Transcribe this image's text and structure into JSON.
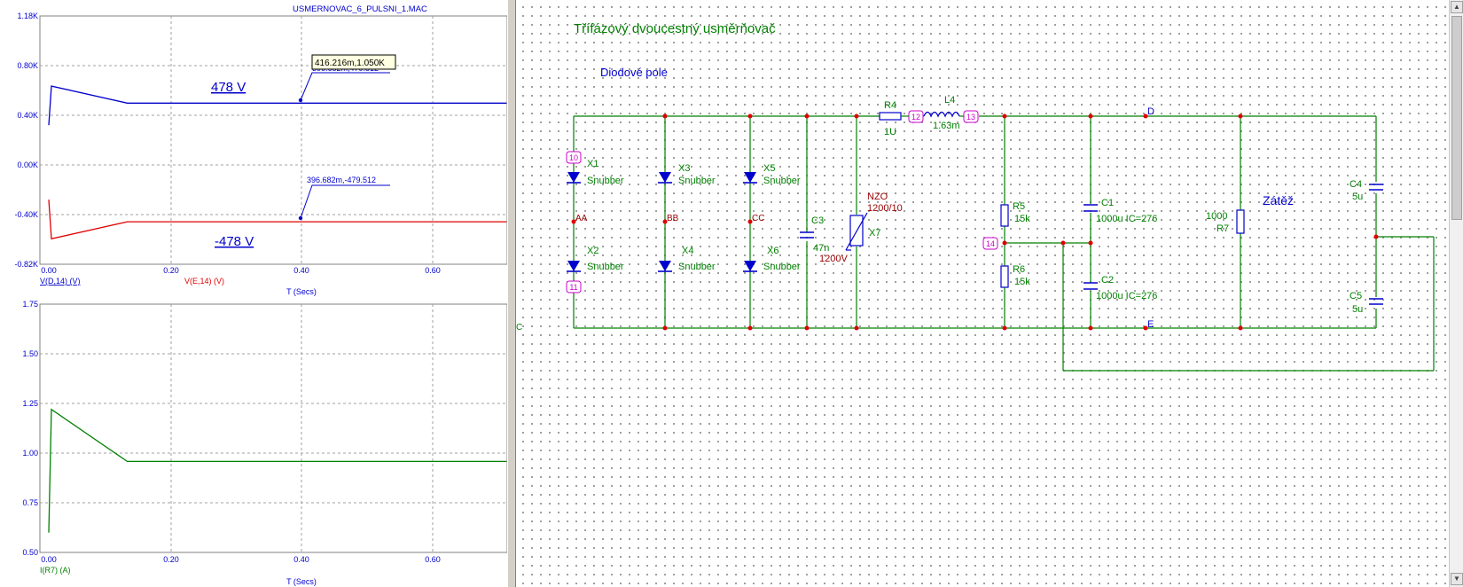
{
  "plot_window": {
    "file_title": "USMERNOVAC_6_PULSNI_1.MAC",
    "cursor_tooltip": "416.216m,1.050K",
    "top_plot": {
      "y_ticks": [
        "1.18K",
        "0.80K",
        "0.40K",
        "0.00K",
        "-0.40K",
        "-0.82K"
      ],
      "x_ticks": [
        "0.00",
        "0.20",
        "0.40",
        "0.60"
      ],
      "x_label": "T (Secs)",
      "legend": [
        "V(D,14) (V)",
        "V(E,14) (V)"
      ],
      "annotation_pos": "478 V",
      "annotation_neg": "-478 V",
      "cursor_pos_partial": "396.682m,479.512",
      "cursor_neg": "396.682m,-479.512"
    },
    "bottom_plot": {
      "y_ticks": [
        "1.75",
        "1.50",
        "1.25",
        "1.00",
        "0.75",
        "0.50"
      ],
      "x_ticks": [
        "0.00",
        "0.20",
        "0.40",
        "0.60"
      ],
      "x_label": "T (Secs)",
      "legend": [
        "I(R7) (A)"
      ]
    }
  },
  "schematic": {
    "title": "Třífázový dvoucestný usměrňovač",
    "subtitle": "Diodové pole",
    "load_label": "Zátěž",
    "nodes": {
      "n10": "10",
      "n11": "11",
      "n12": "12",
      "n13": "13",
      "n14": "14",
      "AA": "AA",
      "BB": "BB",
      "CC": "CC",
      "D": "D",
      "E": "E",
      "C": "C"
    },
    "components": {
      "X1": "X1",
      "X2": "X2",
      "X3": "X3",
      "X4": "X4",
      "X5": "X5",
      "X6": "X6",
      "X7": "X7",
      "snubber": "Snubber",
      "C3": "C3",
      "C3_val": "47n",
      "C3_volt": "1200V",
      "NZO": "NZO",
      "NZO_val": "1200/10",
      "R4": "R4",
      "R4_val": "1U",
      "L4": "L4",
      "L4_val": "1.63m",
      "R5": "R5",
      "R5_val": "15k",
      "R6": "R6",
      "R6_val": "15k",
      "C1": "C1",
      "C1_val": "1000u IC=276",
      "C2": "C2",
      "C2_val": "1000u IC=276",
      "R7": "R7",
      "R7_val": "1000",
      "C4": "C4",
      "C4_val": "5u",
      "C5": "C5",
      "C5_val": "5u"
    }
  },
  "chart_data": [
    {
      "type": "line",
      "x_label": "T (Secs)",
      "xlim": [
        0,
        0.7
      ],
      "ylim": [
        -820,
        1180
      ],
      "grid": true,
      "series": [
        {
          "name": "V(D,14) (V)",
          "color": "#0000cc",
          "x": [
            0,
            0.004,
            0.12,
            0.7
          ],
          "y": [
            300,
            615,
            478,
            478
          ]
        },
        {
          "name": "V(E,14) (V)",
          "color": "#e00000",
          "x": [
            0,
            0.004,
            0.12,
            0.7
          ],
          "y": [
            -300,
            -615,
            -478,
            -478
          ]
        }
      ]
    },
    {
      "type": "line",
      "x_label": "T (Secs)",
      "xlim": [
        0,
        0.7
      ],
      "ylim": [
        0.5,
        1.75
      ],
      "grid": true,
      "series": [
        {
          "name": "I(R7) (A)",
          "color": "#008000",
          "x": [
            0,
            0.004,
            0.12,
            0.7
          ],
          "y": [
            0.6,
            1.22,
            0.958,
            0.958
          ]
        }
      ]
    }
  ],
  "colors": {
    "blue": "#0000cc",
    "red": "#e00000",
    "green": "#008000",
    "magenta": "#cc00cc",
    "darkred": "#990000"
  }
}
